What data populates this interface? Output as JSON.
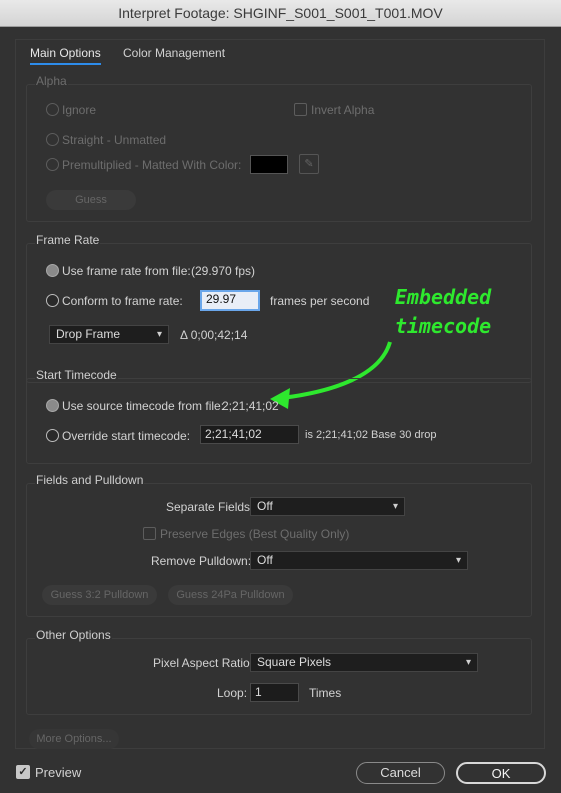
{
  "window": {
    "title": "Interpret Footage: SHGINF_S001_S001_T001.MOV"
  },
  "tabs": [
    {
      "label": "Main Options"
    },
    {
      "label": "Color Management"
    }
  ],
  "alpha": {
    "title": "Alpha",
    "ignore": "Ignore",
    "invert": "Invert Alpha",
    "straight": "Straight - Unmatted",
    "premultiplied": "Premultiplied - Matted With Color:",
    "guess": "Guess"
  },
  "frame_rate": {
    "title": "Frame Rate",
    "use_file": "Use frame rate from file:",
    "file_fps": "(29.970 fps)",
    "conform": "Conform to frame rate:",
    "conform_value": "29.97",
    "fps_suffix": "frames per second",
    "drop_frame": "Drop Frame",
    "delta": "Δ 0;00;42;14"
  },
  "annotation": {
    "line1": "Embedded",
    "line2": "timecode",
    "color": "#2ee82e"
  },
  "start_timecode": {
    "title": "Start Timecode",
    "use_source": "Use source timecode from file:",
    "source_value": "2;21;41;02",
    "override": "Override start timecode:",
    "override_value": "2;21;41;02",
    "info": "is 2;21;41;02  Base 30  drop"
  },
  "fields": {
    "title": "Fields and Pulldown",
    "separate_label": "Separate Fields:",
    "separate_value": "Off",
    "preserve": "Preserve Edges (Best Quality Only)",
    "remove_label": "Remove Pulldown:",
    "remove_value": "Off",
    "guess32": "Guess 3:2 Pulldown",
    "guess24": "Guess 24Pa Pulldown"
  },
  "other": {
    "title": "Other Options",
    "par_label": "Pixel Aspect Ratio:",
    "par_value": "Square Pixels",
    "loop_label": "Loop:",
    "loop_value": "1",
    "times": "Times"
  },
  "footer": {
    "more": "More Options...",
    "preview": "Preview",
    "cancel": "Cancel",
    "ok": "OK"
  }
}
